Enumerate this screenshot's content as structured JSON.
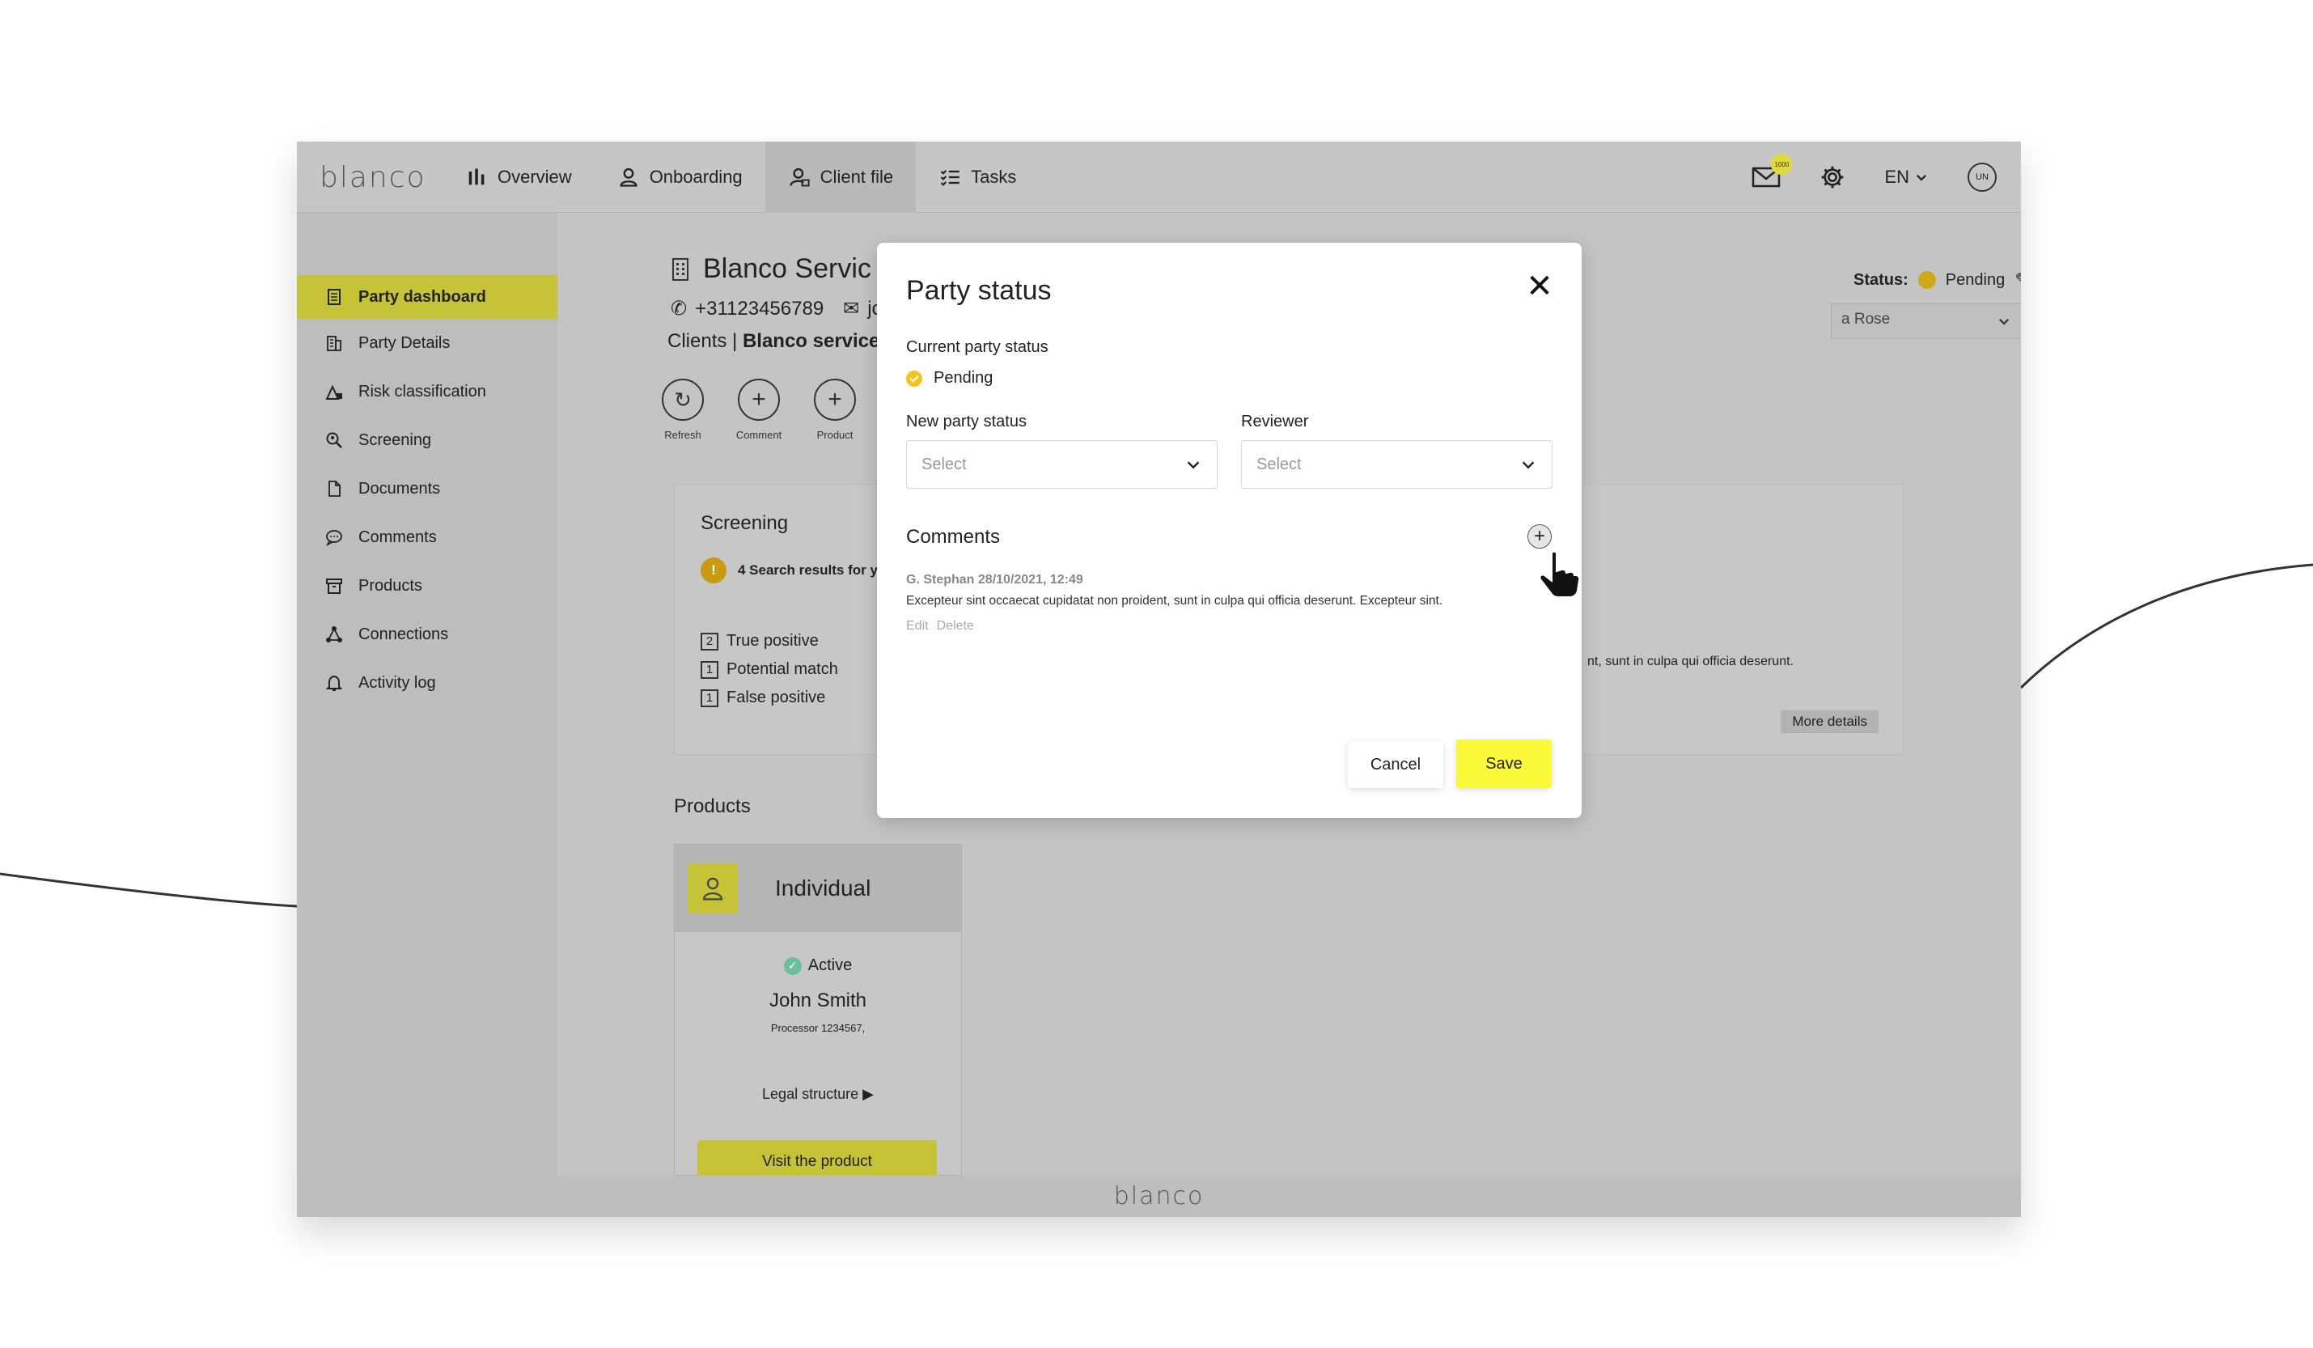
{
  "app": {
    "logo": "blanco",
    "footer_logo": "blanco"
  },
  "nav": {
    "items": [
      {
        "label": "Overview",
        "icon": "bar-chart-icon"
      },
      {
        "label": "Onboarding",
        "icon": "user-icon"
      },
      {
        "label": "Client file",
        "icon": "client-file-icon"
      },
      {
        "label": "Tasks",
        "icon": "tasks-icon"
      }
    ],
    "active": "Client file",
    "mail_badge": "1000",
    "language": "EN",
    "user_initials": "UN"
  },
  "sidebar": {
    "items": [
      {
        "label": "Party dashboard",
        "icon": "dashboard-icon"
      },
      {
        "label": "Party Details",
        "icon": "building-icon"
      },
      {
        "label": "Risk classification",
        "icon": "risk-icon"
      },
      {
        "label": "Screening",
        "icon": "screening-icon"
      },
      {
        "label": "Documents",
        "icon": "document-icon"
      },
      {
        "label": "Comments",
        "icon": "comment-icon"
      },
      {
        "label": "Products",
        "icon": "box-icon"
      },
      {
        "label": "Connections",
        "icon": "connections-icon"
      },
      {
        "label": "Activity log",
        "icon": "bell-icon"
      }
    ]
  },
  "party": {
    "name": "Blanco Servic",
    "phone": "+31123456789",
    "email": "jc",
    "crumb_prefix": "Clients |",
    "crumb_current": "Blanco services",
    "status_label": "Status:",
    "status_value": "Pending",
    "assignee": "a Rose"
  },
  "quick_actions": [
    {
      "label": "Refresh",
      "glyph": "↻"
    },
    {
      "label": "Comment",
      "glyph": "+"
    },
    {
      "label": "Product",
      "glyph": "+"
    }
  ],
  "screening": {
    "title": "Screening",
    "warning": "4 Search results for y",
    "counts": [
      {
        "num": "2",
        "label": "True positive"
      },
      {
        "num": "1",
        "label": "Potential match"
      },
      {
        "num": "1",
        "label": "False positive"
      }
    ],
    "snippet": "nt, sunt in culpa qui officia deserunt.",
    "more": "More details"
  },
  "products": {
    "title": "Products",
    "card": {
      "type": "Individual",
      "status": "Active",
      "name": "John Smith",
      "processor": "Processor 1234567,",
      "legal": "Legal structure ▶",
      "visit": "Visit the product"
    }
  },
  "modal": {
    "title": "Party status",
    "current_label": "Current party status",
    "current_value": "Pending",
    "new_status_label": "New party status",
    "new_status_placeholder": "Select",
    "reviewer_label": "Reviewer",
    "reviewer_placeholder": "Select",
    "comments_label": "Comments",
    "comment": {
      "meta": "G. Stephan 28/10/2021, 12:49",
      "text": "Excepteur sint occaecat cupidatat non proident, sunt in culpa qui officia deserunt. Excepteur sint.",
      "edit": "Edit",
      "delete": "Delete"
    },
    "cancel": "Cancel",
    "save": "Save"
  },
  "colors": {
    "accent": "#c6c338",
    "save_yellow": "#fafa3a",
    "pending_yellow": "#f3c51e",
    "overlay_gray": "#c4c4c4"
  }
}
